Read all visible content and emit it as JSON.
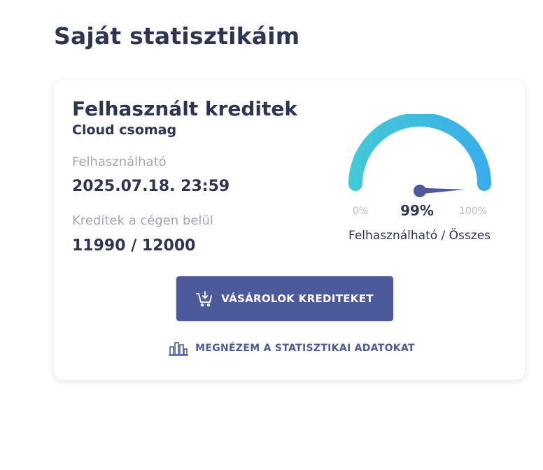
{
  "page": {
    "title": "Saját statisztikáim"
  },
  "card": {
    "title": "Felhasznált kreditek",
    "subtitle": "Cloud csomag",
    "expiry_label": "Felhasználható",
    "expiry_value": "2025.07.18. 23:59",
    "credits_label": "Kreditek a cégen belül",
    "credits_value": "11990 / 12000"
  },
  "gauge": {
    "percent": 99,
    "percent_label": "99%",
    "min_label": "0%",
    "max_label": "100%",
    "caption": "Felhasználható / Összes",
    "colors": {
      "start": "#42c8d6",
      "end": "#3aaeea",
      "needle": "#4c5a9c"
    }
  },
  "actions": {
    "buy_label": "VÁSÁROLOK KREDITEKET",
    "buy_icon": "cart-download-icon",
    "stats_label": "MEGNÉZEM A STATISZTIKAI ADATOKAT",
    "stats_icon": "bar-chart-icon",
    "accent_color": "#4c5a9c"
  }
}
